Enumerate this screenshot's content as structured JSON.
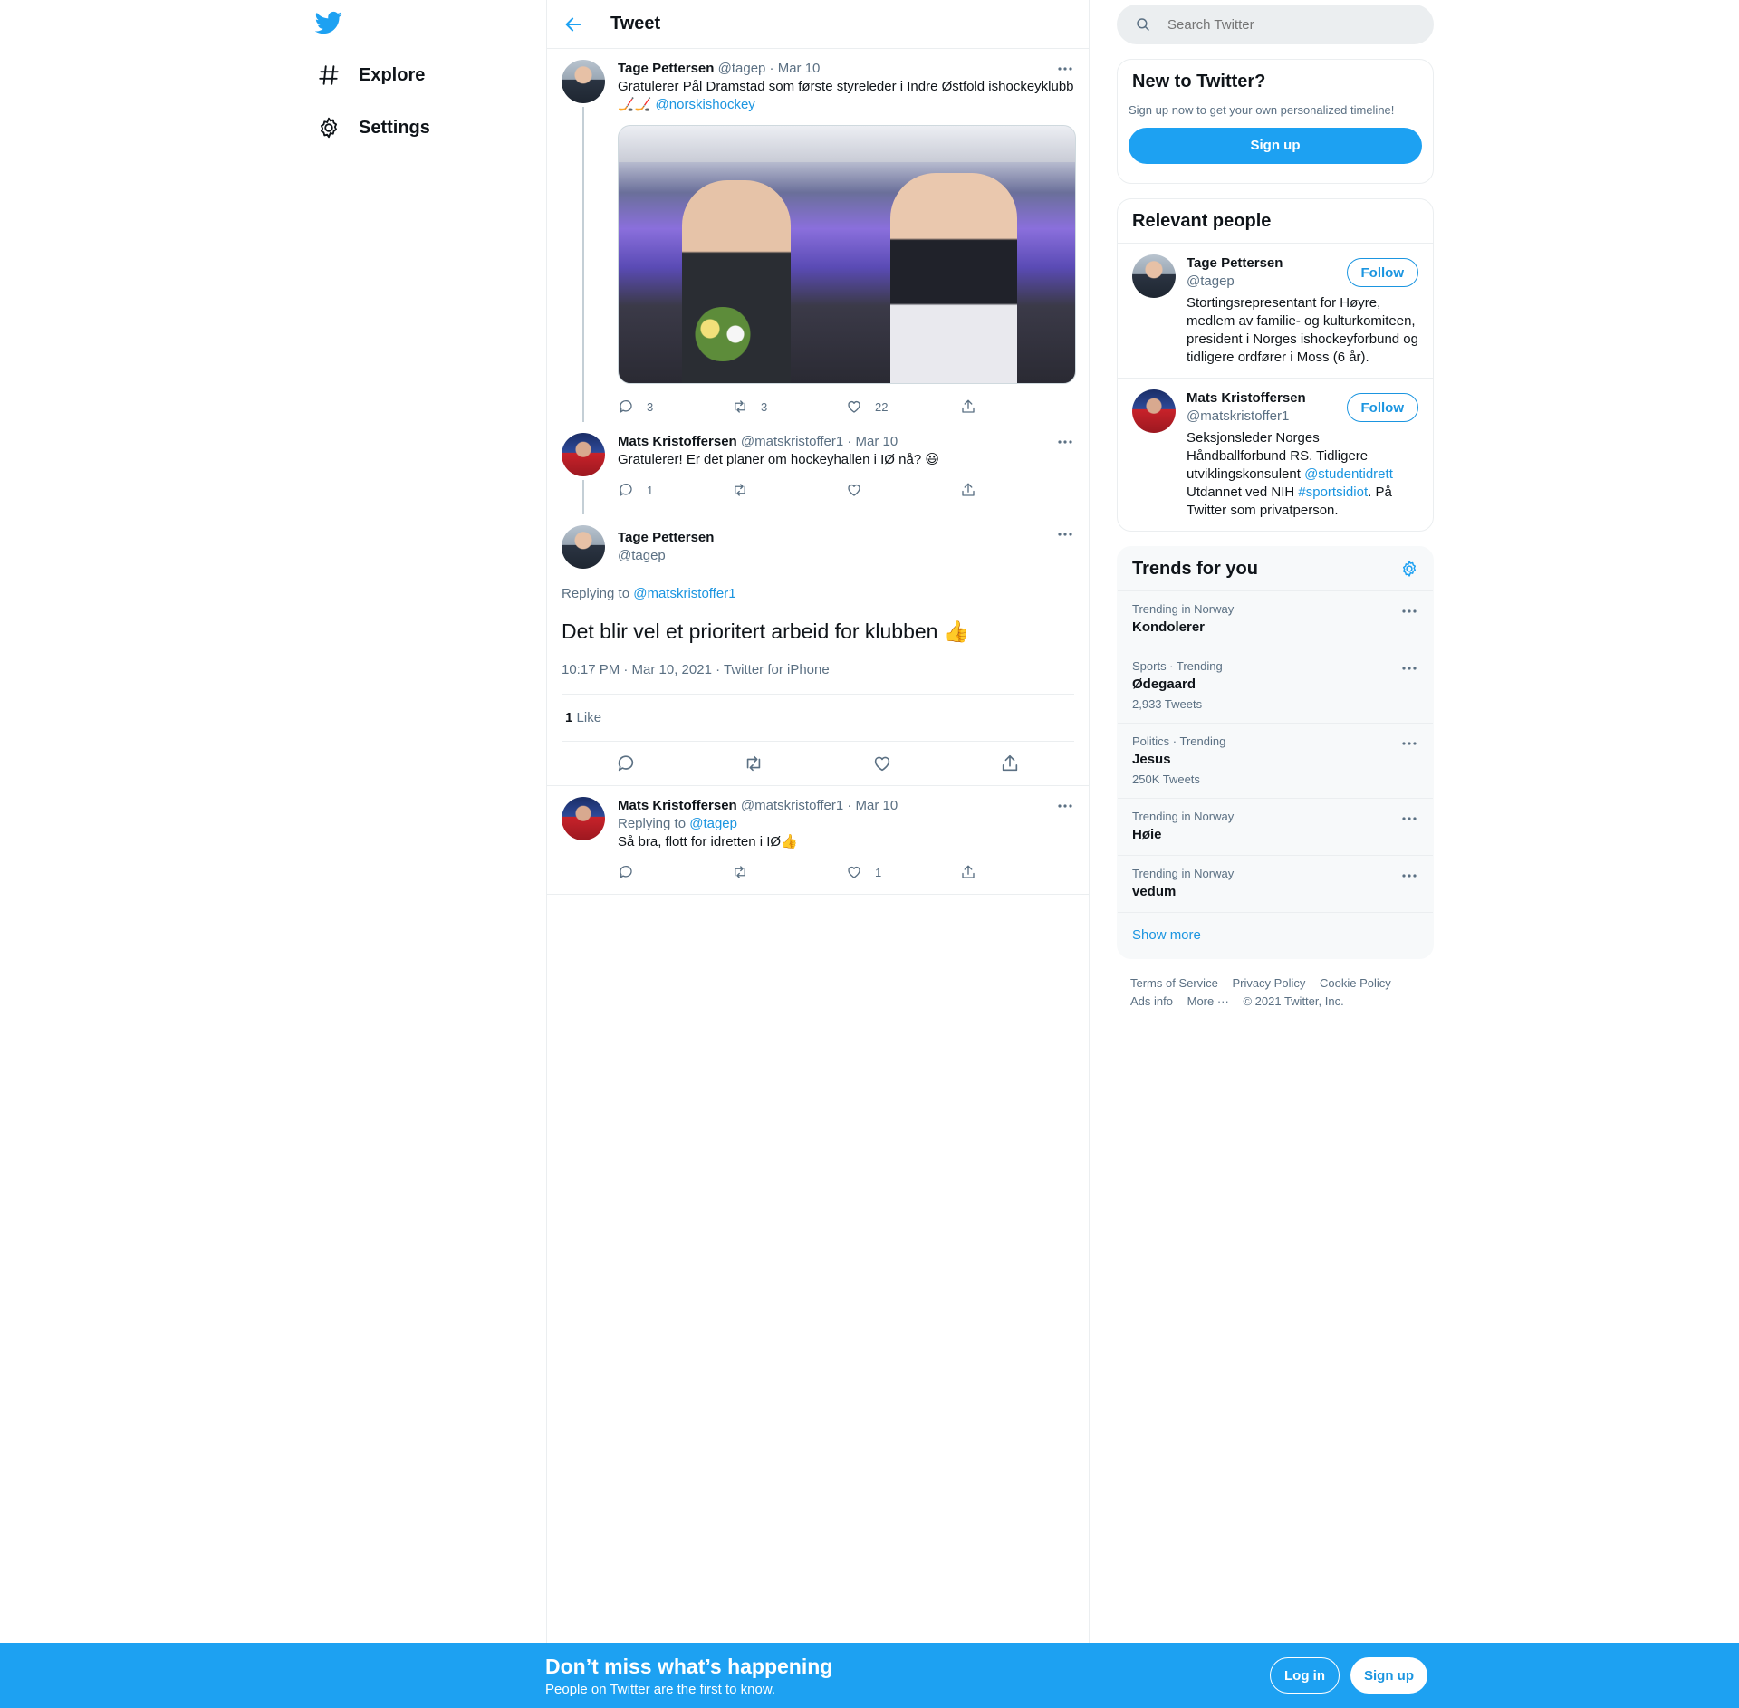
{
  "nav": {
    "logo_icon": "twitter-bird-icon",
    "items": [
      {
        "label": "Explore",
        "icon": "hashtag-icon"
      },
      {
        "label": "Settings",
        "icon": "gear-icon"
      }
    ]
  },
  "header": {
    "title": "Tweet",
    "back_icon": "arrow-left-icon"
  },
  "tweets": [
    {
      "name": "Tage Pettersen",
      "handle": "@tagep",
      "date": "· Mar 10",
      "text": "Gratulerer Pål Dramstad som første styreleder i Indre Østfold ishockeyklubb",
      "emoji": "🏒🏒",
      "mention": "@norskishockey",
      "replies": "3",
      "retweets": "3",
      "likes": "22"
    },
    {
      "name": "Mats Kristoffersen",
      "handle": "@matskristoffer1",
      "date": "· Mar 10",
      "text": "Gratulerer! Er det planer om hockeyhallen i IØ nå? 😃",
      "replies": "1",
      "retweets": "",
      "likes": ""
    }
  ],
  "focused": {
    "name": "Tage Pettersen",
    "handle": "@tagep",
    "replying_prefix": "Replying to",
    "replying_to": "@matskristoffer1",
    "text": "Det blir vel et prioritert arbeid for klubben 👍",
    "timestamp": "10:17 PM · Mar 10, 2021 · Twitter for iPhone",
    "like_count": "1",
    "like_label": "Like"
  },
  "reply": {
    "name": "Mats Kristoffersen",
    "handle": "@matskristoffer1",
    "date": "· Mar 10",
    "replying_prefix": "Replying to",
    "replying_to": "@tagep",
    "text": "Så bra, flott for idretten i IØ👍",
    "replies": "",
    "retweets": "",
    "likes": "1"
  },
  "search": {
    "placeholder": "Search Twitter"
  },
  "new_to_twitter": {
    "title": "New to Twitter?",
    "subtitle": "Sign up now to get your own personalized timeline!",
    "signup": "Sign up"
  },
  "relevant": {
    "title": "Relevant people",
    "follow_label": "Follow",
    "people": [
      {
        "name": "Tage Pettersen",
        "handle": "@tagep",
        "bio": "Stortingsrepresentant for Høyre, medlem av familie- og kulturkomiteen, president i Norges ishockeyforbund og tidligere ordfører i Moss (6 år)."
      },
      {
        "name": "Mats Kristoffersen",
        "handle": "@matskristoffer1",
        "bio_1": "Seksjonsleder Norges Håndballforbund RS. Tidligere utviklingskonsulent",
        "bio_link1": "@studentidrett",
        "bio_2": "Utdannet ved NIH",
        "bio_link2": "#sportsidiot",
        "bio_3": ". På Twitter som privatperson."
      }
    ]
  },
  "trends": {
    "title": "Trends for you",
    "items": [
      {
        "context": "Trending in Norway",
        "name": "Kondolerer",
        "count": ""
      },
      {
        "context": "Sports · Trending",
        "name": "Ødegaard",
        "count": "2,933 Tweets"
      },
      {
        "context": "Politics · Trending",
        "name": "Jesus",
        "count": "250K Tweets"
      },
      {
        "context": "Trending in Norway",
        "name": "Høie",
        "count": ""
      },
      {
        "context": "Trending in Norway",
        "name": "vedum",
        "count": ""
      }
    ],
    "show_more": "Show more"
  },
  "footer": {
    "links": [
      "Terms of Service",
      "Privacy Policy",
      "Cookie Policy",
      "Ads info",
      "More ···"
    ],
    "copyright": "© 2021 Twitter, Inc."
  },
  "bottom_bar": {
    "title": "Don’t miss what’s happening",
    "subtitle": "People on Twitter are the first to know.",
    "login": "Log in",
    "signup": "Sign up"
  },
  "colors": {
    "accent": "#1da1f2",
    "link": "#1b95e0",
    "muted": "#5b7083"
  }
}
